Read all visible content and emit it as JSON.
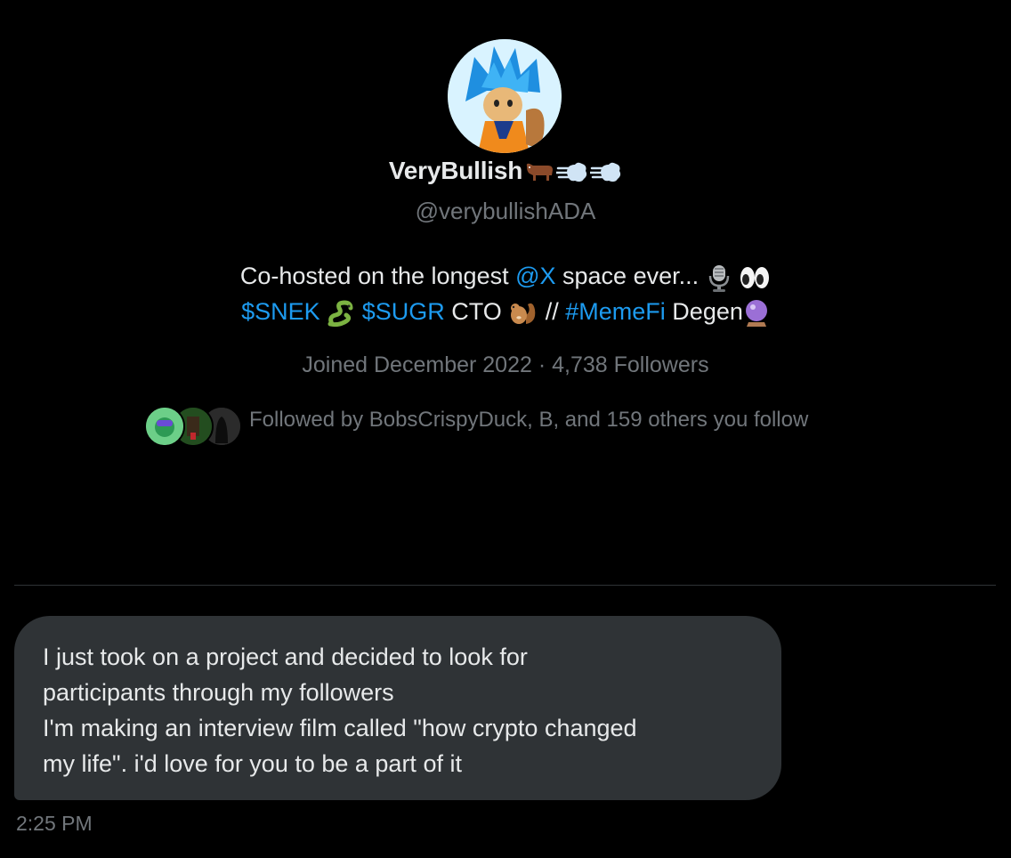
{
  "profile": {
    "display_name": "VeryBullish",
    "handle": "@verybullishADA",
    "bio_line1": {
      "prefix": "Co-hosted on the longest ",
      "mention": "@X",
      "suffix": " space ever... "
    },
    "bio_line2": {
      "token1": "$SNEK",
      "token2": "$SUGR",
      "text1": " CTO ",
      "sep": " // ",
      "hashtag": "#MemeFi",
      "text2": " Degen"
    },
    "joined": "Joined December 2022",
    "separator": " · ",
    "followers": "4,738 Followers",
    "followed_by": "Followed by BobsCrispyDuck, B, and 159 others you follow"
  },
  "message": {
    "text": "I just took on a project and decided to look for\nparticipants through my followers\nI'm making an interview film called \"how crypto changed\nmy life\". i'd love for you to be a part of it",
    "time": "2:25 PM"
  },
  "icons": [
    "bull-emoji-icon",
    "dash-emoji-icon",
    "microphone-emoji-icon",
    "eyes-emoji-icon",
    "snake-emoji-icon",
    "chipmunk-emoji-icon",
    "crystal-ball-emoji-icon"
  ],
  "colors": {
    "background": "#000000",
    "link": "#1d9bf0",
    "bubble": "#2f3336",
    "muted": "#71767b"
  }
}
